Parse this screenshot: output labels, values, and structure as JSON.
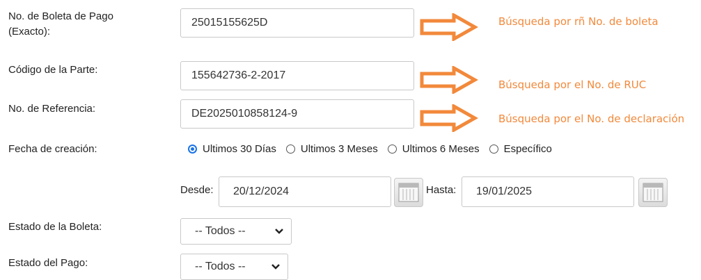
{
  "fields": {
    "boleta": {
      "label_line1": "No. de Boleta de Pago",
      "label_line2": "(Exacto):",
      "value": "25015155625D"
    },
    "codigo": {
      "label": "Código de la Parte:",
      "value": "155642736-2-2017"
    },
    "referencia": {
      "label": "No. de Referencia:",
      "value": "DE2025010858124-9"
    },
    "fecha": {
      "label": "Fecha de creación:",
      "options": [
        "Ultimos 30 Días",
        "Ultimos 3 Meses",
        "Ultimos 6 Meses",
        "Específico"
      ],
      "selected_index": 0,
      "desde_label": "Desde:",
      "desde_value": "20/12/2024",
      "hasta_label": "Hasta:",
      "hasta_value": "19/01/2025"
    },
    "estado_boleta": {
      "label": "Estado de la Boleta:",
      "value": "-- Todos --"
    },
    "estado_pago": {
      "label": "Estado del Pago:",
      "value": "-- Todos --"
    }
  },
  "annotations": {
    "boleta_note": "Búsqueda por rñ No. de boleta",
    "ruc_note": "Búsqueda por el No. de RUC",
    "declaracion_note": "Búsqueda por el No. de declaración"
  },
  "colors": {
    "annotation": "#f2893b",
    "radio_selected": "#1a73e8"
  },
  "icons": {
    "arrow": "arrow-right-icon",
    "calendar": "calendar-icon",
    "dropdown": "chevron-down-icon"
  }
}
